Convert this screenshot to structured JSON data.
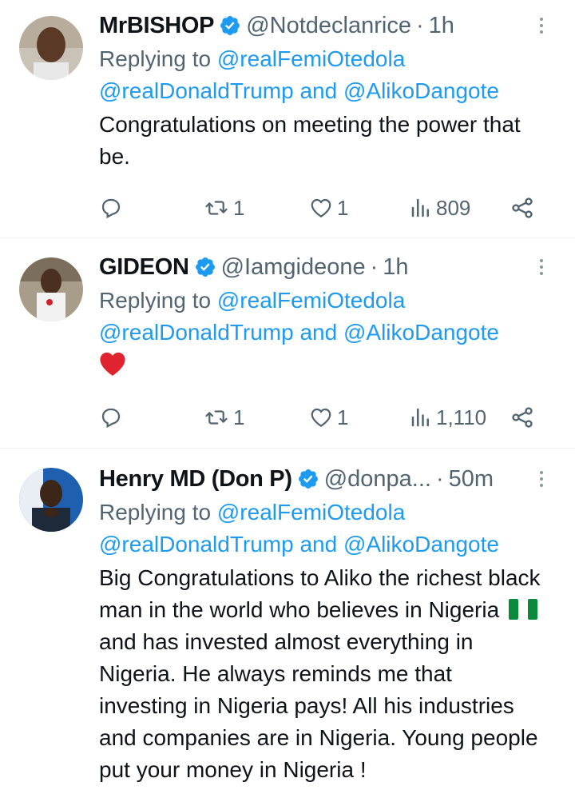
{
  "tweets": [
    {
      "name": "MrBISHOP",
      "handle": "@Notdeclanrice",
      "separator": "·",
      "time": "1h",
      "replying_prefix": "Replying to ",
      "replying_to_1": "@realFemiOtedola",
      "replying_to_2": "@realDonaldTrump",
      "replying_and": " and ",
      "replying_to_3": "@AlikoDangote",
      "text": "Congratulations on meeting the power that be.",
      "retweets": "1",
      "likes": "1",
      "views": "809"
    },
    {
      "name": "GIDEON",
      "handle": "@Iamgideone",
      "separator": "·",
      "time": "1h",
      "replying_prefix": "Replying to ",
      "replying_to_1": "@realFemiOtedola",
      "replying_to_2": "@realDonaldTrump",
      "replying_and": " and ",
      "replying_to_3": "@AlikoDangote",
      "text_emoji": "heart-emoji",
      "retweets": "1",
      "likes": "1",
      "views": "1,110"
    },
    {
      "name": "Henry MD (Don P)",
      "handle": "@donpa...",
      "separator": "·",
      "time": "50m",
      "replying_prefix": "Replying to ",
      "replying_to_1": "@realFemiOtedola",
      "replying_to_2": "@realDonaldTrump",
      "replying_and": " and ",
      "replying_to_3": "@AlikoDangote",
      "text_part_1": "Big Congratulations to Aliko the richest black man in the world who believes in Nigeria",
      "text_emoji": "nigeria-flag-emoji",
      "text_part_2": "and has invested almost everything in Nigeria. He always reminds me that investing in Nigeria pays! All his industries and companies are in Nigeria. Young people put your money in Nigeria !"
    }
  ],
  "icons": {
    "verified": "verified-badge-icon",
    "more": "more-options-icon",
    "reply": "reply-icon",
    "retweet": "retweet-icon",
    "like": "like-icon",
    "views": "views-icon",
    "share": "share-icon"
  },
  "colors": {
    "text": "#0f1419",
    "secondary": "#536471",
    "link": "#1d9bf0",
    "verified": "#1d9bf0",
    "divider": "#eff3f4"
  }
}
